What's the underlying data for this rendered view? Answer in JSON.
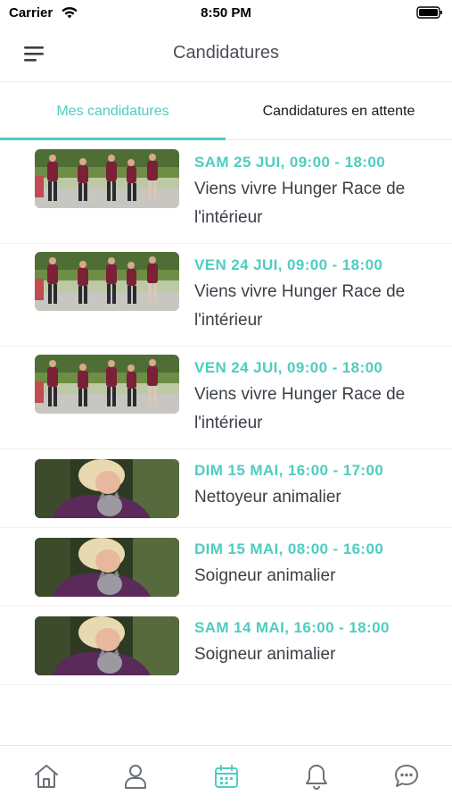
{
  "status_bar": {
    "carrier": "Carrier",
    "time": "8:50 PM"
  },
  "nav": {
    "title": "Candidatures",
    "menu_icon": "hamburger-menu-icon"
  },
  "tabs": [
    {
      "label": "Mes candidatures",
      "active": true
    },
    {
      "label": "Candidatures en attente",
      "active": false
    }
  ],
  "items": [
    {
      "date": "SAM 25 JUI, 09:00 - 18:00",
      "title": "Viens vivre Hunger Race de l'intérieur",
      "image": "group-walking-photo"
    },
    {
      "date": "VEN 24 JUI, 09:00 - 18:00",
      "title": "Viens vivre Hunger Race de l'intérieur",
      "image": "group-walking-photo"
    },
    {
      "date": "VEN 24 JUI, 09:00 - 18:00",
      "title": "Viens vivre Hunger Race de l'intérieur",
      "image": "group-walking-photo"
    },
    {
      "date": "DIM 15 MAI, 16:00 - 17:00",
      "title": "Nettoyeur animalier",
      "image": "woman-with-cat-photo"
    },
    {
      "date": "DIM 15 MAI, 08:00 - 16:00",
      "title": "Soigneur animalier",
      "image": "woman-with-cat-photo"
    },
    {
      "date": "SAM 14 MAI, 16:00 - 18:00",
      "title": "Soigneur animalier",
      "image": "woman-with-cat-photo"
    }
  ],
  "bottom_tabs": [
    {
      "icon": "home-icon",
      "active": false
    },
    {
      "icon": "profile-icon",
      "active": false
    },
    {
      "icon": "calendar-icon",
      "active": true
    },
    {
      "icon": "bell-icon",
      "active": false
    },
    {
      "icon": "chat-icon",
      "active": false
    }
  ],
  "colors": {
    "accent": "#4ecdc0",
    "text": "#3a4048",
    "icon": "#6b7178"
  }
}
